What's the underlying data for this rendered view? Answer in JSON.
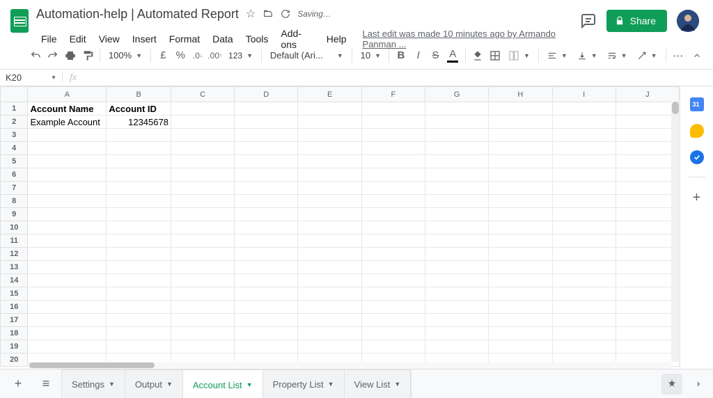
{
  "doc": {
    "title": "Automation-help | Automated Report",
    "saving_label": "Saving…"
  },
  "menu": {
    "file": "File",
    "edit": "Edit",
    "view": "View",
    "insert": "Insert",
    "format": "Format",
    "data": "Data",
    "tools": "Tools",
    "addons": "Add-ons",
    "help": "Help",
    "last_edit": "Last edit was made 10 minutes ago by Armando Panman ..."
  },
  "share": {
    "label": "Share"
  },
  "toolbar": {
    "zoom": "100%",
    "font": "Default (Ari...",
    "font_size": "10",
    "more": "⋯"
  },
  "name_box": "K20",
  "columns": [
    "A",
    "B",
    "C",
    "D",
    "E",
    "F",
    "G",
    "H",
    "I",
    "J"
  ],
  "row_count": 20,
  "cells": {
    "A1": "Account Name",
    "B1": "Account ID",
    "A2": "Example Account",
    "B2": "12345678"
  },
  "tabs": [
    {
      "label": "Settings",
      "active": false
    },
    {
      "label": "Output",
      "active": false
    },
    {
      "label": "Account List",
      "active": true
    },
    {
      "label": "Property List",
      "active": false
    },
    {
      "label": "View List",
      "active": false
    }
  ]
}
